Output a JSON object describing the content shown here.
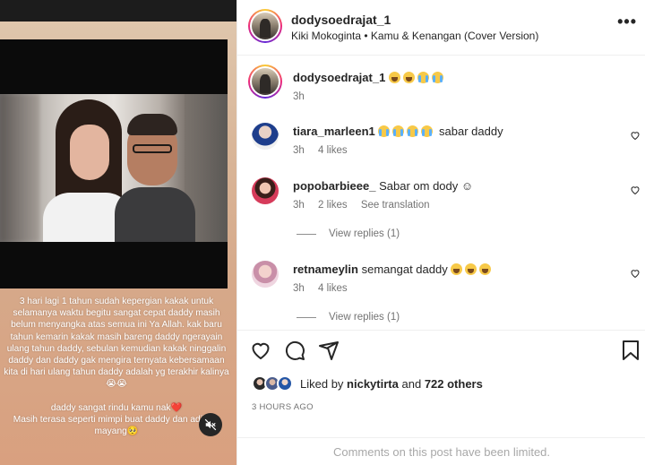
{
  "post": {
    "username": "dodysoedrajat_1",
    "audio": "Kiki Mokoginta • Kamu & Kenangan (Cover Version)",
    "more_label": "•••"
  },
  "media": {
    "caption_lines": [
      "3 hari lagi 1 tahun sudah kepergian kakak untuk selamanya waktu begitu sangat cepat daddy masih belum menyangka atas semua ini Ya Allah. kak baru tahun kemarin kakak masih bareng daddy ngerayain ulang tahun daddy, sebulan kemudian kakak ninggalin daddy dan daddy gak mengira ternyata  kebersamaan kita di hari ulang tahun daddy adalah yg terakhir kalinya😭😭",
      "daddy sangat rindu kamu nak❤️",
      "Masih terasa seperti mimpi buat daddy dan adikmu mayang🥺"
    ]
  },
  "caption_comment": {
    "username": "dodysoedrajat_1",
    "time": "3h"
  },
  "comments": [
    {
      "username": "tiara_marleen1",
      "text": "sabar daddy",
      "time": "3h",
      "likes": "4 likes"
    },
    {
      "username": "popobarbieee_",
      "text": "Sabar om dody ☺",
      "time": "3h",
      "likes": "2 likes",
      "translate": "See translation",
      "replies": "View replies (1)"
    },
    {
      "username": "retnameylin",
      "text": "semangat daddy",
      "time": "3h",
      "likes": "4 likes",
      "replies": "View replies (1)"
    }
  ],
  "likes_summary": {
    "prefix": "Liked by",
    "user": "nickytirta",
    "and": "and",
    "others": "722 others"
  },
  "timestamp": "3 HOURS AGO",
  "limited_notice": "Comments on this post have been limited.",
  "colors": {
    "text": "#262626",
    "muted": "#737373",
    "border": "#efefef"
  }
}
